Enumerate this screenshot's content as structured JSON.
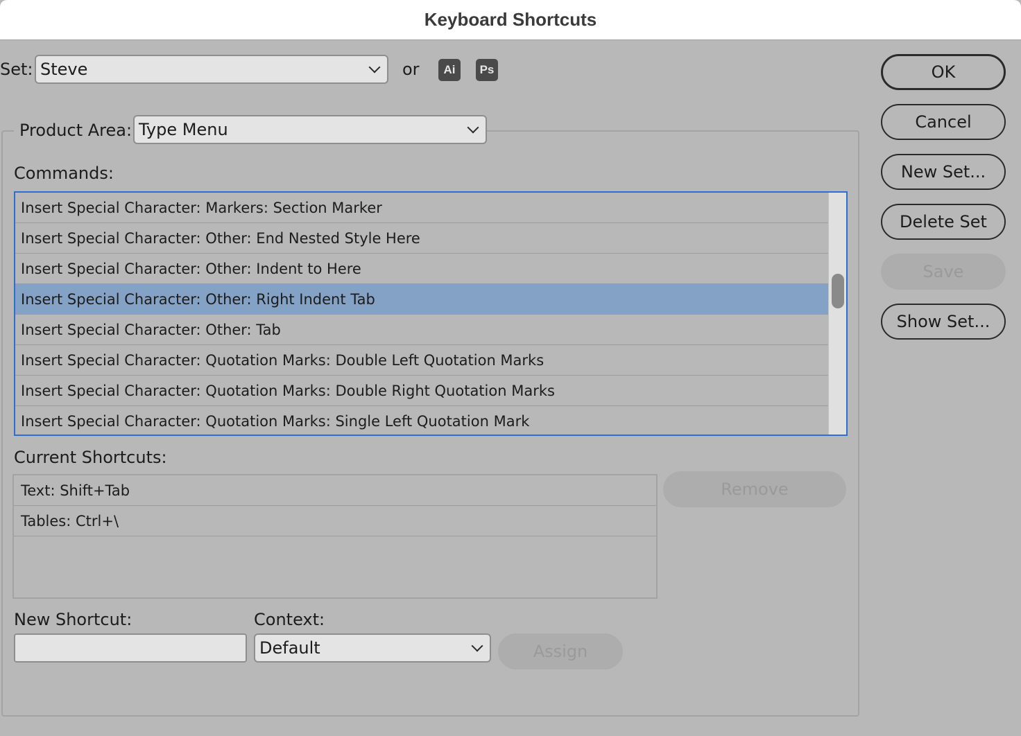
{
  "window": {
    "title": "Keyboard Shortcuts"
  },
  "set": {
    "label": "Set:",
    "value": "Steve",
    "or_label": "or",
    "ai_badge": "Ai",
    "ps_badge": "Ps"
  },
  "product_area": {
    "label": "Product Area:",
    "value": "Type Menu"
  },
  "commands": {
    "label": "Commands:",
    "items": [
      "Insert Special Character: Markers: Section Marker",
      "Insert Special Character: Other: End Nested Style Here",
      "Insert Special Character: Other: Indent to Here",
      "Insert Special Character: Other: Right Indent Tab",
      "Insert Special Character: Other: Tab",
      "Insert Special Character: Quotation Marks: Double Left Quotation Marks",
      "Insert Special Character: Quotation Marks: Double Right Quotation Marks",
      "Insert Special Character: Quotation Marks: Single Left Quotation Mark"
    ],
    "selected_index": 3
  },
  "current_shortcuts": {
    "label": "Current Shortcuts:",
    "items": [
      "Text: Shift+Tab",
      "Tables: Ctrl+\\"
    ],
    "remove_label": "Remove"
  },
  "new_shortcut": {
    "label": "New Shortcut:",
    "value": ""
  },
  "context": {
    "label": "Context:",
    "value": "Default"
  },
  "assign_label": "Assign",
  "buttons": {
    "ok": "OK",
    "cancel": "Cancel",
    "new_set": "New Set...",
    "delete_set": "Delete Set",
    "save": "Save",
    "show_set": "Show Set..."
  }
}
